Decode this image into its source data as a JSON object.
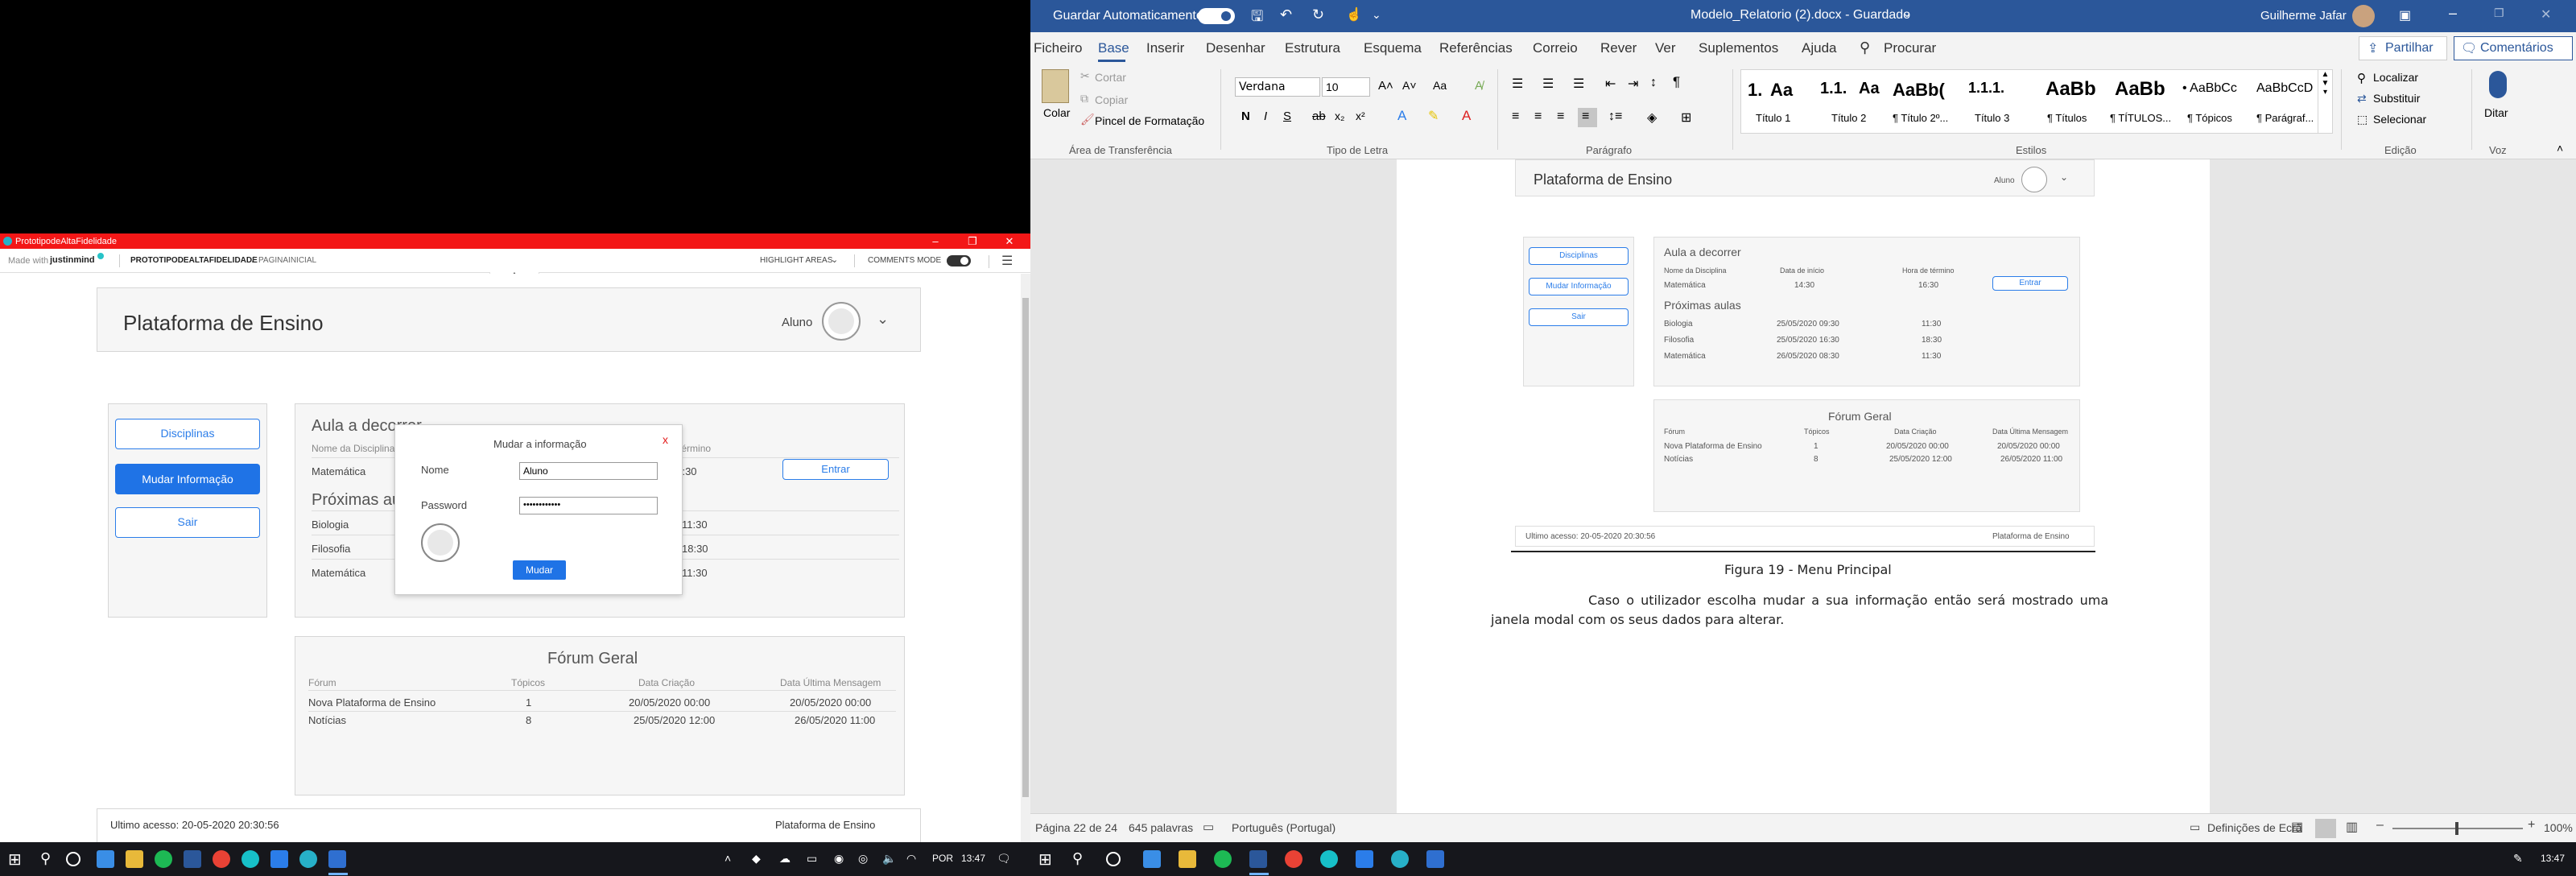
{
  "left_app": {
    "window_title": "PrototipodeAltaFidelidade",
    "jm_made_with": "Made with",
    "jm_brand": "justinmind",
    "breadcrumb_project": "PROTOTIPODEALTAFIDELIDADE",
    "breadcrumb_sep": "/",
    "breadcrumb_page": "PAGINAINICIAL",
    "highlight_areas": "HIGHLIGHT AREAS",
    "comments_mode": "COMMENTS MODE",
    "header_title": "Plataforma de Ensino",
    "user_label": "Aluno",
    "nav": {
      "disciplinas": "Disciplinas",
      "mudar": "Mudar Informação",
      "sair": "Sair"
    },
    "aula_title": "Aula a decorrer",
    "aula_cols": {
      "nome": "Nome da Disciplina",
      "inicio": "Data de início",
      "termino": "Hora de término"
    },
    "aula_row": {
      "nome": "Matemática",
      "inicio": "14:30",
      "termino": "16:30"
    },
    "entrar": "Entrar",
    "proximas_title": "Próximas aulas",
    "proximas": [
      {
        "nome": "Biologia",
        "inicio": "25/05/2020 09:30",
        "fim": "11:30"
      },
      {
        "nome": "Filosofia",
        "inicio": "25/05/2020 16:30",
        "fim": "18:30"
      },
      {
        "nome": "Matemática",
        "inicio": "26/05/2020 08:30",
        "fim": "11:30"
      }
    ],
    "modal": {
      "title": "Mudar a informação",
      "close": "x",
      "nome_label": "Nome",
      "nome_value": "Aluno",
      "password_label": "Password",
      "password_value": "••••••••••••",
      "submit": "Mudar"
    },
    "forum": {
      "title": "Fórum Geral",
      "cols": [
        "Fórum",
        "Tópicos",
        "Data Criação",
        "Data Última Mensagem"
      ],
      "rows": [
        [
          "Nova Plataforma de Ensino",
          "1",
          "20/05/2020 00:00",
          "20/05/2020 00:00"
        ],
        [
          "Notícias",
          "8",
          "25/05/2020 12:00",
          "26/05/2020 11:00"
        ]
      ]
    },
    "footer_left": "Ultimo acesso: 20-05-2020 20:30:56",
    "footer_right": "Plataforma de Ensino"
  },
  "word": {
    "autosave": "Guardar Automaticamente",
    "doc_title": "Modelo_Relatorio (2).docx - Guardado",
    "user": "Guilherme Jafar",
    "tabs": [
      "Ficheiro",
      "Base",
      "Inserir",
      "Desenhar",
      "Estrutura",
      "Esquema",
      "Referências",
      "Correio",
      "Rever",
      "Ver",
      "Suplementos",
      "Ajuda"
    ],
    "search": "Procurar",
    "share": "Partilhar",
    "comments": "Comentários",
    "clipboard": {
      "paste": "Colar",
      "cut": "Cortar",
      "copy": "Copiar",
      "painter": "Pincel de Formatação",
      "group": "Área de Transferência"
    },
    "font": {
      "name": "Verdana",
      "size": "10",
      "group": "Tipo de Letra"
    },
    "paragraph_group": "Parágrafo",
    "styles": [
      {
        "preview": "1.",
        "preview2": "Aa",
        "name": "Título 1"
      },
      {
        "preview": "1.1.",
        "preview2": "Aa",
        "name": "Título 2"
      },
      {
        "preview": "AaBb(",
        "preview2": "",
        "name": "¶ Título 2º..."
      },
      {
        "preview": "1.1.1.",
        "preview2": "",
        "name": "Título 3"
      },
      {
        "preview": "AaBb",
        "preview2": "",
        "name": "¶ Títulos"
      },
      {
        "preview": "AaBb",
        "preview2": "",
        "name": "¶ TÍTULOS..."
      },
      {
        "preview": "• AaBbCc",
        "preview2": "",
        "name": "¶ Tópicos"
      },
      {
        "preview": "AaBbCcD",
        "preview2": "",
        "name": "¶ Parágraf..."
      }
    ],
    "styles_group": "Estilos",
    "editing": {
      "find": "Localizar",
      "replace": "Substituir",
      "select": "Selecionar",
      "group": "Edição"
    },
    "voice": {
      "dictate": "Ditar",
      "group": "Voz"
    },
    "figure_caption": "Figura 19 - Menu Principal",
    "body_text_line1": "Caso o utilizador escolha mudar a sua informação então será mostrado uma",
    "body_text_line2": "janela modal com os seus dados para alterar.",
    "status": {
      "page": "Página 22 de 24",
      "words": "645 palavras",
      "language": "Português (Portugal)",
      "display": "Definições de Ecrã",
      "zoom": "100%"
    }
  },
  "taskbar": {
    "left_lang": "POR",
    "left_time": "13:47",
    "right_time": "13:47"
  }
}
